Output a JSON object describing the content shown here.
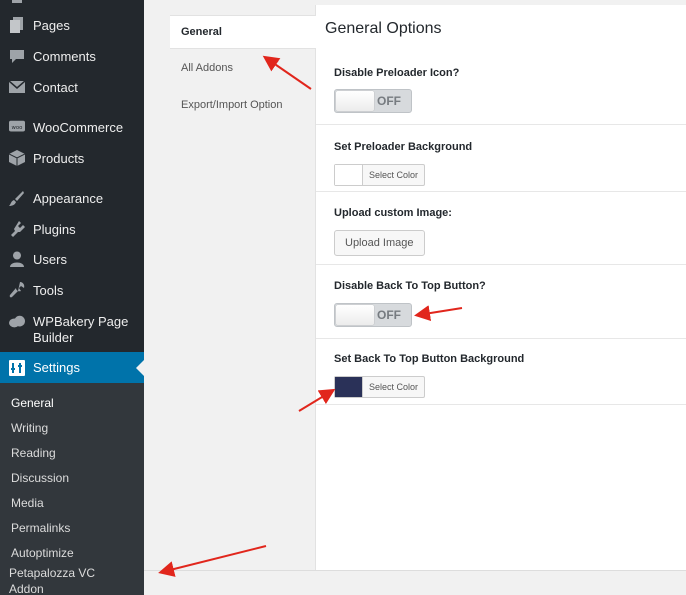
{
  "sidebar": {
    "items": [
      {
        "label": "Pages",
        "icon": "pages-icon"
      },
      {
        "label": "Comments",
        "icon": "comments-icon"
      },
      {
        "label": "Contact",
        "icon": "mail-icon"
      },
      {
        "label": "WooCommerce",
        "icon": "woocommerce-icon"
      },
      {
        "label": "Products",
        "icon": "products-icon"
      },
      {
        "label": "Appearance",
        "icon": "paintbrush-icon"
      },
      {
        "label": "Plugins",
        "icon": "plugin-icon"
      },
      {
        "label": "Users",
        "icon": "users-icon"
      },
      {
        "label": "Tools",
        "icon": "wrench-icon"
      },
      {
        "label": "WPBakery Page",
        "label2": "Builder",
        "icon": "wpbakery-icon"
      },
      {
        "label": "Settings",
        "icon": "settings-icon"
      }
    ],
    "submenu": [
      "General",
      "Writing",
      "Reading",
      "Discussion",
      "Media",
      "Permalinks",
      "Autoptimize",
      "Petapalozza VC",
      "Addon"
    ]
  },
  "tabs": [
    {
      "label": "General"
    },
    {
      "label": "All Addons"
    },
    {
      "label": "Export/Import Option"
    }
  ],
  "main": {
    "title": "General Options",
    "options": {
      "preloader_icon": {
        "label": "Disable Preloader Icon?",
        "toggle": "OFF"
      },
      "preloader_bg": {
        "label": "Set Preloader Background",
        "button": "Select Color",
        "color": "#ffffff"
      },
      "custom_image": {
        "label": "Upload custom Image:",
        "button": "Upload Image"
      },
      "back_to_top": {
        "label": "Disable Back To Top Button?",
        "toggle": "OFF"
      },
      "back_to_top_bg": {
        "label": "Set Back To Top Button Background",
        "button": "Select Color",
        "color": "#2a3158"
      }
    }
  },
  "colors": {
    "sidebar": "#23282d",
    "accent": "#0073aa",
    "arrow": "#e1261c"
  }
}
